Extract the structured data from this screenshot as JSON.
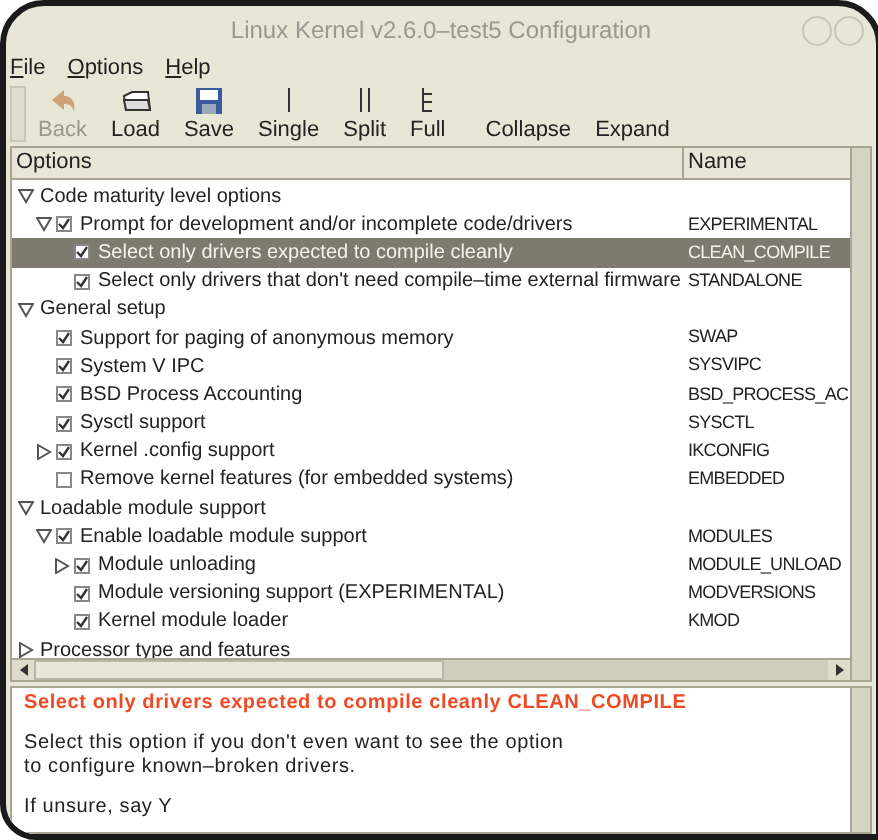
{
  "window": {
    "title": "Linux Kernel v2.6.0–test5 Configuration"
  },
  "menu": [
    "File",
    "Options",
    "Help"
  ],
  "toolbar": [
    {
      "label": "Back",
      "disabled": true
    },
    {
      "label": "Load",
      "disabled": false
    },
    {
      "label": "Save",
      "disabled": false
    },
    {
      "label": "Single",
      "disabled": false
    },
    {
      "label": "Split",
      "disabled": false
    },
    {
      "label": "Full",
      "disabled": false
    },
    {
      "label": "Collapse",
      "disabled": false
    },
    {
      "label": "Expand",
      "disabled": false
    }
  ],
  "tree": {
    "columns": [
      "Options",
      "Name"
    ],
    "rows": [
      {
        "label": "Code maturity level options",
        "expanded": true,
        "selected": false,
        "children": [
          {
            "label": "Prompt for development and/or incomplete code/drivers",
            "name": "EXPERIMENTAL",
            "expanded": true,
            "checked": true,
            "selected": false,
            "children": [
              {
                "label": "Select only drivers expected to compile cleanly",
                "name": "CLEAN_COMPILE",
                "checked": true,
                "selected": true
              },
              {
                "label": "Select only drivers that don't need compile–time external firmware",
                "name": "STANDALONE",
                "checked": true,
                "selected": false
              }
            ]
          }
        ]
      },
      {
        "label": "General setup",
        "expanded": true,
        "selected": false,
        "children": [
          {
            "label": "Support for paging of anonymous memory",
            "name": "SWAP",
            "checked": true,
            "selected": false
          },
          {
            "label": "System V IPC",
            "name": "SYSVIPC",
            "checked": true,
            "selected": false
          },
          {
            "label": "BSD Process Accounting",
            "name": "BSD_PROCESS_AC",
            "checked": true,
            "selected": false
          },
          {
            "label": "Sysctl support",
            "name": "SYSCTL",
            "checked": true,
            "selected": false
          },
          {
            "label": "Kernel .config support",
            "name": "IKCONFIG",
            "expanded": false,
            "checked": true,
            "selected": false
          },
          {
            "label": "Remove kernel features (for embedded systems)",
            "name": "EMBEDDED",
            "checked": false,
            "selected": false
          }
        ]
      },
      {
        "label": "Loadable module support",
        "expanded": true,
        "selected": false,
        "children": [
          {
            "label": "Enable loadable module support",
            "name": "MODULES",
            "expanded": true,
            "checked": true,
            "selected": false,
            "children": [
              {
                "label": "Module unloading",
                "name": "MODULE_UNLOAD",
                "expanded": false,
                "checked": true,
                "selected": false
              },
              {
                "label": "Module versioning support (EXPERIMENTAL)",
                "name": "MODVERSIONS",
                "checked": true,
                "selected": false
              },
              {
                "label": "Kernel module loader",
                "name": "KMOD",
                "checked": true,
                "selected": false
              }
            ]
          }
        ]
      },
      {
        "label": "Processor type and features",
        "expanded": false,
        "selected": false
      }
    ]
  },
  "help": {
    "heading": "Select only drivers expected to compile cleanly CLEAN_COMPILE",
    "paragraphs": [
      "Select this option if you don't even want to see the option\nto configure known–broken drivers.",
      "If unsure, say Y"
    ]
  }
}
